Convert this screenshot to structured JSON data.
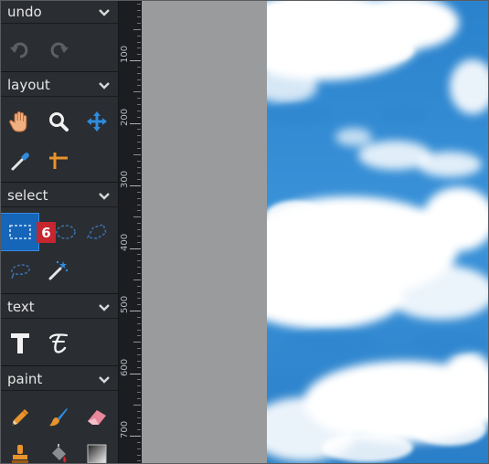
{
  "sections": {
    "undo": {
      "title": "undo"
    },
    "layout": {
      "title": "layout"
    },
    "select": {
      "title": "select"
    },
    "text": {
      "title": "text"
    },
    "paint": {
      "title": "paint"
    }
  },
  "badge": {
    "label": "6"
  },
  "ruler": {
    "labels": [
      "100",
      "200",
      "300",
      "400",
      "500",
      "600",
      "700"
    ]
  },
  "icons": {
    "undo": "undo-arrow-icon",
    "redo": "redo-arrow-icon",
    "hand": "hand-icon",
    "zoom": "magnifier-icon",
    "move": "move-arrows-icon",
    "eyedropper": "eyedropper-icon",
    "crop": "crop-icon",
    "rect_select": "rectangle-select-icon",
    "ellipse_select": "ellipse-select-icon",
    "lasso": "lasso-icon",
    "poly_lasso": "polygon-lasso-icon",
    "magic_wand": "magic-wand-icon",
    "text": "text-T-icon",
    "text_style": "text-style-icon",
    "pencil": "pencil-icon",
    "brush": "brush-icon",
    "eraser": "eraser-icon",
    "stamp": "clone-stamp-icon",
    "fill": "paint-bucket-icon",
    "gradient": "gradient-icon"
  },
  "colors": {
    "panel_bg": "#2a2d31",
    "active_tool": "#1565b8",
    "badge": "#c6262e",
    "accent_orange": "#e8932c",
    "accent_blue": "#2f8ce0",
    "pasteboard": "#9a9b9c",
    "sky": "#2f86cf"
  },
  "tools": {
    "selected": "rectangle-select"
  }
}
